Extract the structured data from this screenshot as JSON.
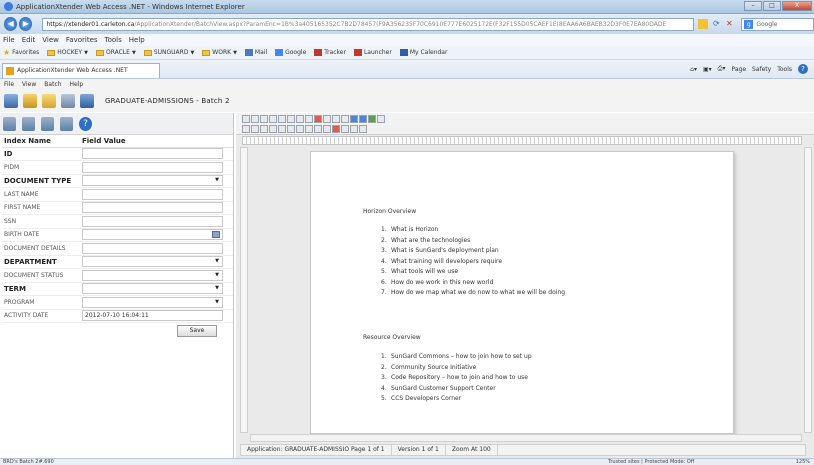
{
  "window": {
    "title": "ApplicationXtender Web Access .NET - Windows Internet Explorer",
    "buttons": [
      "–",
      "□",
      "X"
    ]
  },
  "address_bar": {
    "url_host": "https://xtender01.carleton.ca",
    "url_rest": "/ApplicationXtender/BatchView.aspx?ParamEnc=1B%3a405165352C7B2D78457(F9A356235F70C6910E777E6025172E(F32F155D05CAEF1E(8EAA6A6BAEB32D3F0E7EA80DADE",
    "search_label": "Google"
  },
  "menu": [
    "File",
    "Edit",
    "View",
    "Favorites",
    "Tools",
    "Help"
  ],
  "favorites": [
    {
      "label": "Favorites",
      "kind": "star"
    },
    {
      "label": "HOCKEY",
      "kind": "folder",
      "dropdown": true
    },
    {
      "label": "ORACLE",
      "kind": "folder",
      "dropdown": true
    },
    {
      "label": "SUNGUARD",
      "kind": "folder",
      "dropdown": true
    },
    {
      "label": "WORK",
      "kind": "folder",
      "dropdown": true
    },
    {
      "label": "Mail",
      "kind": "mail"
    },
    {
      "label": "Google",
      "kind": "google"
    },
    {
      "label": "Tracker",
      "kind": "tracker"
    },
    {
      "label": "Launcher",
      "kind": "launcher"
    },
    {
      "label": "My Calendar",
      "kind": "calendar"
    }
  ],
  "tab": {
    "label": "ApplicationXtender Web Access .NET"
  },
  "commandbar": [
    "Page",
    "Safety",
    "Tools"
  ],
  "app_menu": [
    "File",
    "View",
    "Batch",
    "Help"
  ],
  "doc_title": "GRADUATE-ADMISSIONS - Batch 2",
  "index_table": {
    "headers": [
      "Index Name",
      "Field Value"
    ],
    "rows": [
      {
        "name": "ID",
        "bold": true,
        "value": "",
        "control": "text"
      },
      {
        "name": "PIDM",
        "bold": false,
        "value": "",
        "control": "text"
      },
      {
        "name": "DOCUMENT TYPE",
        "bold": true,
        "value": "",
        "control": "dropdown"
      },
      {
        "name": "LAST NAME",
        "bold": false,
        "value": "",
        "control": "text"
      },
      {
        "name": "FIRST NAME",
        "bold": false,
        "value": "",
        "control": "text"
      },
      {
        "name": "SSN",
        "bold": false,
        "value": "",
        "control": "text"
      },
      {
        "name": "BIRTH DATE",
        "bold": false,
        "value": "",
        "control": "date"
      },
      {
        "name": "DOCUMENT DETAILS",
        "bold": false,
        "value": "",
        "control": "text"
      },
      {
        "name": "DEPARTMENT",
        "bold": true,
        "value": "",
        "control": "dropdown"
      },
      {
        "name": "DOCUMENT STATUS",
        "bold": false,
        "value": "",
        "control": "dropdown"
      },
      {
        "name": "TERM",
        "bold": true,
        "value": "",
        "control": "dropdown"
      },
      {
        "name": "PROGRAM",
        "bold": false,
        "value": "",
        "control": "dropdown"
      },
      {
        "name": "ACTIVITY DATE",
        "bold": false,
        "value": "2012-07-10 16:04:11",
        "control": "text"
      }
    ],
    "save_label": "Save"
  },
  "document": {
    "section1": {
      "title": "Horizon Overview",
      "items": [
        "What is Horizon",
        "What are the technologies",
        "What is SunGard's deployment plan",
        "What training will developers require",
        "What tools will we use",
        "How do we work in this new world",
        "How do we map what we do now to what we will be doing"
      ]
    },
    "section2": {
      "title": "Resource Overview",
      "items": [
        "SunGard Commons – how to join how to set up",
        "Community Source Initiative",
        "Code Repository – how to join and how to use",
        "SunGard Customer Support Center",
        "CCS Developers Corner"
      ]
    }
  },
  "viewer_status": {
    "application": "Application: GRADUATE-ADMISSIO  Page 1 of 1",
    "version": "Version 1 of 1",
    "zoom": "Zoom At 100"
  },
  "browser_status": {
    "left": "BRD's Batch 2#.690",
    "mid": "Trusted sites | Protected Mode: Off",
    "zoom": "125%"
  }
}
